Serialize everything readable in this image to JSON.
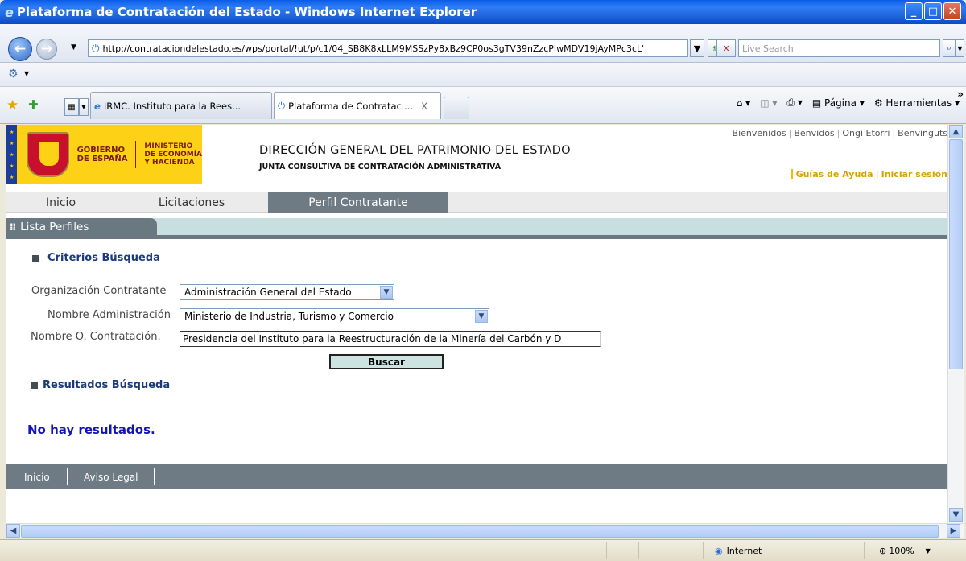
{
  "window": {
    "title": "Plataforma de Contratación del Estado - Windows Internet Explorer",
    "buttons": [
      "_",
      "□",
      "X"
    ]
  },
  "address": {
    "url": "http://contrataciondelestado.es/wps/portal/!ut/p/c1/04_SB8K8xLLM9MSSzPy8xBz9CP0os3gTV39nZzcPIwMDV19jAyMPc3cL'",
    "search_placeholder": "Live Search"
  },
  "tabs": [
    {
      "label": "IRMC. Instituto para la Rees..."
    },
    {
      "label": "Plataforma de Contrataci...",
      "close": "X"
    }
  ],
  "commandbar": {
    "pagina": "Página",
    "herramientas": "Herramientas"
  },
  "header": {
    "gobierno": "GOBIERNO\nDE ESPAÑA",
    "ministerio": "MINISTERIO\nDE ECONOMÍA\nY HACIENDA",
    "direccion": "DIRECCIÓN GENERAL DEL PATRIMONIO DEL ESTADO",
    "junta": "JUNTA CONSULTIVA DE CONTRATACIÓN ADMINISTRATIVA",
    "langs": [
      "Bienvenidos",
      "Benvidos",
      "Ongi Etorri",
      "Benvinguts"
    ],
    "guias": "Guías de Ayuda",
    "iniciar": "Iniciar sesión"
  },
  "menu": [
    "Inicio",
    "Licitaciones",
    "Perfil Contratante"
  ],
  "section_tab": "Lista Perfiles",
  "criterios": {
    "title": "Criterios Búsqueda",
    "org_label": "Organización Contratante",
    "org_value": "Administración General del Estado",
    "adm_label": "Nombre Administración",
    "adm_value": "Ministerio de Industria, Turismo y Comercio",
    "oc_label": "Nombre O. Contratación.",
    "oc_value": "Presidencia del Instituto para la Reestructuración de la Minería del Carbón y D",
    "buscar": "Buscar"
  },
  "resultados": {
    "title": "Resultados Búsqueda",
    "empty": "No hay resultados."
  },
  "footer": [
    "Inicio",
    "Aviso Legal"
  ],
  "status": {
    "zone": "Internet",
    "zoom": "100%"
  }
}
